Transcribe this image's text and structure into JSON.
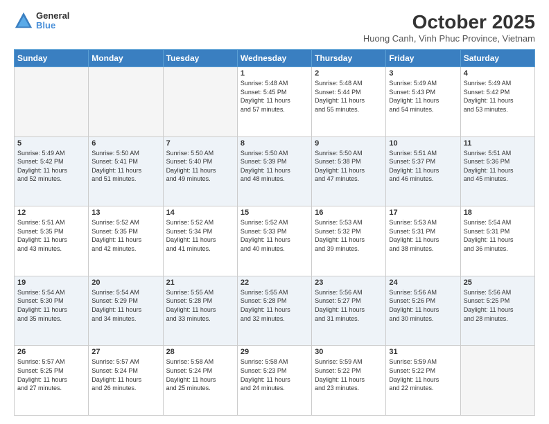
{
  "logo": {
    "line1": "General",
    "line2": "Blue"
  },
  "title": "October 2025",
  "subtitle": "Huong Canh, Vinh Phuc Province, Vietnam",
  "days_header": [
    "Sunday",
    "Monday",
    "Tuesday",
    "Wednesday",
    "Thursday",
    "Friday",
    "Saturday"
  ],
  "weeks": [
    [
      {
        "day": "",
        "info": ""
      },
      {
        "day": "",
        "info": ""
      },
      {
        "day": "",
        "info": ""
      },
      {
        "day": "1",
        "info": "Sunrise: 5:48 AM\nSunset: 5:45 PM\nDaylight: 11 hours\nand 57 minutes."
      },
      {
        "day": "2",
        "info": "Sunrise: 5:48 AM\nSunset: 5:44 PM\nDaylight: 11 hours\nand 55 minutes."
      },
      {
        "day": "3",
        "info": "Sunrise: 5:49 AM\nSunset: 5:43 PM\nDaylight: 11 hours\nand 54 minutes."
      },
      {
        "day": "4",
        "info": "Sunrise: 5:49 AM\nSunset: 5:42 PM\nDaylight: 11 hours\nand 53 minutes."
      }
    ],
    [
      {
        "day": "5",
        "info": "Sunrise: 5:49 AM\nSunset: 5:42 PM\nDaylight: 11 hours\nand 52 minutes."
      },
      {
        "day": "6",
        "info": "Sunrise: 5:50 AM\nSunset: 5:41 PM\nDaylight: 11 hours\nand 51 minutes."
      },
      {
        "day": "7",
        "info": "Sunrise: 5:50 AM\nSunset: 5:40 PM\nDaylight: 11 hours\nand 49 minutes."
      },
      {
        "day": "8",
        "info": "Sunrise: 5:50 AM\nSunset: 5:39 PM\nDaylight: 11 hours\nand 48 minutes."
      },
      {
        "day": "9",
        "info": "Sunrise: 5:50 AM\nSunset: 5:38 PM\nDaylight: 11 hours\nand 47 minutes."
      },
      {
        "day": "10",
        "info": "Sunrise: 5:51 AM\nSunset: 5:37 PM\nDaylight: 11 hours\nand 46 minutes."
      },
      {
        "day": "11",
        "info": "Sunrise: 5:51 AM\nSunset: 5:36 PM\nDaylight: 11 hours\nand 45 minutes."
      }
    ],
    [
      {
        "day": "12",
        "info": "Sunrise: 5:51 AM\nSunset: 5:35 PM\nDaylight: 11 hours\nand 43 minutes."
      },
      {
        "day": "13",
        "info": "Sunrise: 5:52 AM\nSunset: 5:35 PM\nDaylight: 11 hours\nand 42 minutes."
      },
      {
        "day": "14",
        "info": "Sunrise: 5:52 AM\nSunset: 5:34 PM\nDaylight: 11 hours\nand 41 minutes."
      },
      {
        "day": "15",
        "info": "Sunrise: 5:52 AM\nSunset: 5:33 PM\nDaylight: 11 hours\nand 40 minutes."
      },
      {
        "day": "16",
        "info": "Sunrise: 5:53 AM\nSunset: 5:32 PM\nDaylight: 11 hours\nand 39 minutes."
      },
      {
        "day": "17",
        "info": "Sunrise: 5:53 AM\nSunset: 5:31 PM\nDaylight: 11 hours\nand 38 minutes."
      },
      {
        "day": "18",
        "info": "Sunrise: 5:54 AM\nSunset: 5:31 PM\nDaylight: 11 hours\nand 36 minutes."
      }
    ],
    [
      {
        "day": "19",
        "info": "Sunrise: 5:54 AM\nSunset: 5:30 PM\nDaylight: 11 hours\nand 35 minutes."
      },
      {
        "day": "20",
        "info": "Sunrise: 5:54 AM\nSunset: 5:29 PM\nDaylight: 11 hours\nand 34 minutes."
      },
      {
        "day": "21",
        "info": "Sunrise: 5:55 AM\nSunset: 5:28 PM\nDaylight: 11 hours\nand 33 minutes."
      },
      {
        "day": "22",
        "info": "Sunrise: 5:55 AM\nSunset: 5:28 PM\nDaylight: 11 hours\nand 32 minutes."
      },
      {
        "day": "23",
        "info": "Sunrise: 5:56 AM\nSunset: 5:27 PM\nDaylight: 11 hours\nand 31 minutes."
      },
      {
        "day": "24",
        "info": "Sunrise: 5:56 AM\nSunset: 5:26 PM\nDaylight: 11 hours\nand 30 minutes."
      },
      {
        "day": "25",
        "info": "Sunrise: 5:56 AM\nSunset: 5:25 PM\nDaylight: 11 hours\nand 28 minutes."
      }
    ],
    [
      {
        "day": "26",
        "info": "Sunrise: 5:57 AM\nSunset: 5:25 PM\nDaylight: 11 hours\nand 27 minutes."
      },
      {
        "day": "27",
        "info": "Sunrise: 5:57 AM\nSunset: 5:24 PM\nDaylight: 11 hours\nand 26 minutes."
      },
      {
        "day": "28",
        "info": "Sunrise: 5:58 AM\nSunset: 5:24 PM\nDaylight: 11 hours\nand 25 minutes."
      },
      {
        "day": "29",
        "info": "Sunrise: 5:58 AM\nSunset: 5:23 PM\nDaylight: 11 hours\nand 24 minutes."
      },
      {
        "day": "30",
        "info": "Sunrise: 5:59 AM\nSunset: 5:22 PM\nDaylight: 11 hours\nand 23 minutes."
      },
      {
        "day": "31",
        "info": "Sunrise: 5:59 AM\nSunset: 5:22 PM\nDaylight: 11 hours\nand 22 minutes."
      },
      {
        "day": "",
        "info": ""
      }
    ]
  ]
}
